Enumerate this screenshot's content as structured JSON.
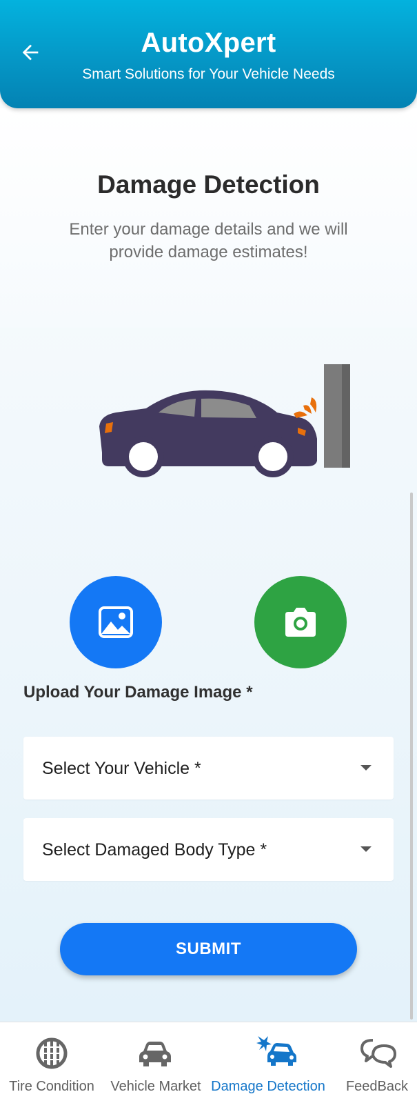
{
  "header": {
    "title": "AutoXpert",
    "subtitle": "Smart Solutions for Your Vehicle Needs",
    "back_icon": "arrow-left-icon"
  },
  "main": {
    "title": "Damage Detection",
    "description": "Enter your damage details and we will provide damage estimates!",
    "illustration": "car-crash-illustration",
    "gallery_icon": "image-icon",
    "camera_icon": "camera-icon",
    "upload_label": "Upload Your Damage Image *",
    "vehicle_select": {
      "placeholder": "Select Your Vehicle *"
    },
    "body_type_select": {
      "placeholder": "Select Damaged Body Type *"
    },
    "submit_label": "SUBMIT"
  },
  "bottom_nav": {
    "items": [
      {
        "label": "Tire Condition",
        "icon": "tire-icon",
        "active": false
      },
      {
        "label": "Vehicle Market",
        "icon": "car-icon",
        "active": false
      },
      {
        "label": "Damage Detection",
        "icon": "car-crash-icon",
        "active": true
      },
      {
        "label": "FeedBack",
        "icon": "chat-bubbles-icon",
        "active": false
      }
    ]
  },
  "colors": {
    "header_top": "#03b2de",
    "header_bottom": "#0382b3",
    "primary_button": "#1478f5",
    "camera_button": "#2ea343",
    "car_body": "#433a5f",
    "crash_accent": "#e8700c",
    "active_nav": "#1476c9"
  }
}
